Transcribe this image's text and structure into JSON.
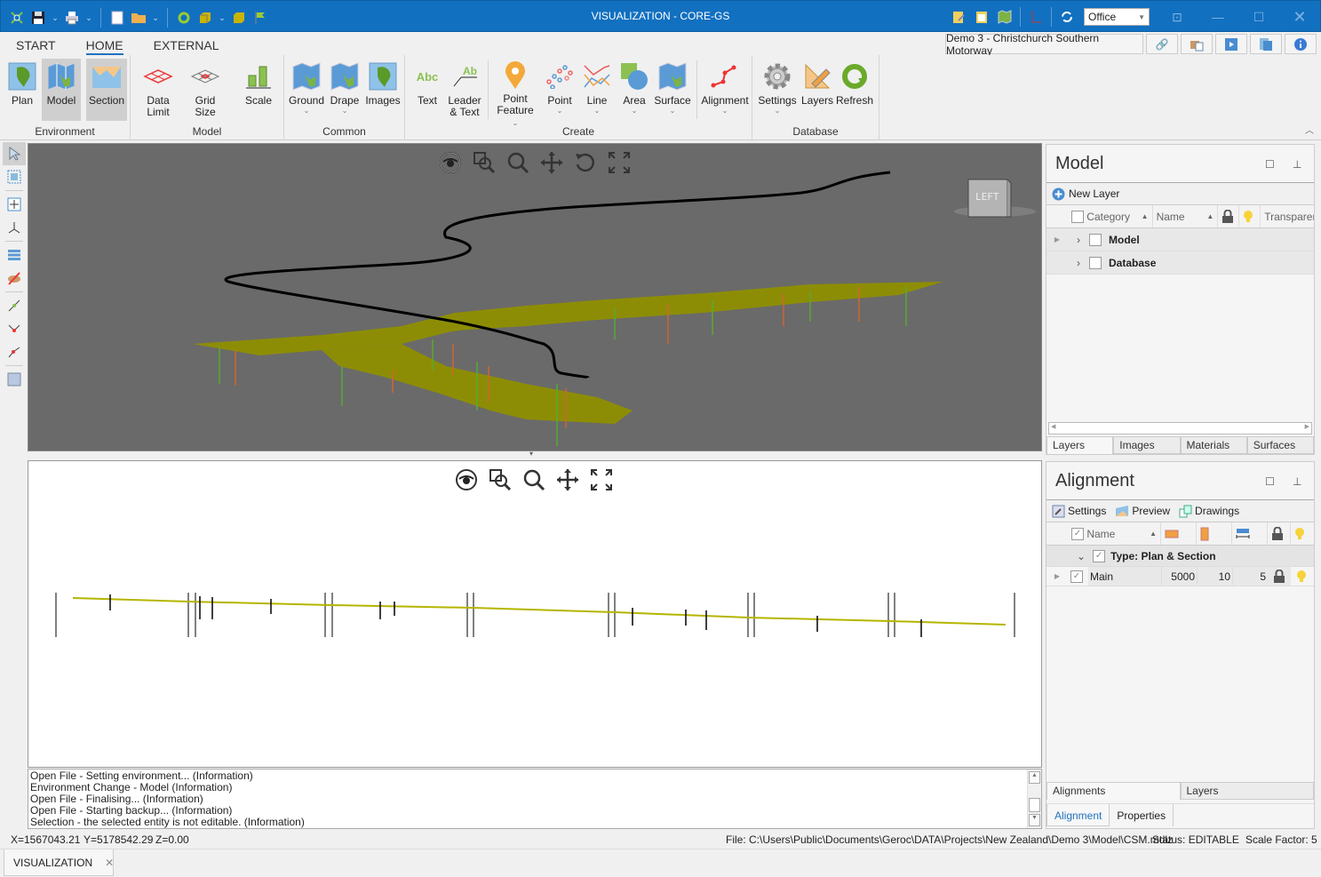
{
  "titlebar": {
    "title": "VISUALIZATION - CORE-GS",
    "qat_icons": [
      "app-logo-icon",
      "save-icon",
      "print-icon",
      "new-document-icon",
      "open-folder-icon",
      "refresh-icon",
      "yellow-box-icon",
      "yellow-cube-icon",
      "flag-icon"
    ],
    "right_icons": [
      "edit-notes-icon",
      "clipboard-icon",
      "map-icon",
      "chart-axis-icon",
      "sync-icon"
    ],
    "theme_value": "Office",
    "window_buttons": [
      "restore-icon",
      "minimize-icon",
      "maximize-icon",
      "close-icon"
    ]
  },
  "tabs": [
    {
      "label": "START"
    },
    {
      "label": "HOME",
      "active": true
    },
    {
      "label": "EXTERNAL"
    }
  ],
  "project_name": "Demo 3 - Christchurch Southern Motorway",
  "project_icons": [
    "link-icon",
    "briefcase-icon",
    "video-icon",
    "help-book-icon",
    "info-icon"
  ],
  "ribbon": {
    "groups": [
      {
        "label": "Environment",
        "buttons": [
          {
            "label": "Plan"
          },
          {
            "label": "Model",
            "selected": true
          },
          {
            "label": "Section",
            "selected": true
          }
        ]
      },
      {
        "label": "Model",
        "buttons": [
          {
            "label": "Data Limit"
          },
          {
            "label": "Grid Size"
          },
          {
            "label": "Scale"
          }
        ]
      },
      {
        "label": "Common",
        "buttons": [
          {
            "label": "Ground"
          },
          {
            "label": "Drape"
          },
          {
            "label": "Images"
          }
        ]
      },
      {
        "label": "Create",
        "buttons": [
          {
            "label": "Text"
          },
          {
            "label": "Leader",
            "label2": "& Text"
          },
          {
            "label": "Point",
            "label2": "Feature"
          },
          {
            "label": "Point"
          },
          {
            "label": "Line"
          },
          {
            "label": "Area"
          },
          {
            "label": "Surface"
          },
          {
            "label": "Alignment"
          }
        ]
      },
      {
        "label": "Database",
        "buttons": [
          {
            "label": "Settings"
          },
          {
            "label": "Layers"
          },
          {
            "label": "Refresh"
          }
        ]
      }
    ]
  },
  "left_toolbar": [
    "select-arrow-icon",
    "box-select-icon",
    "move-points-icon",
    "axis-icon",
    "layers-stack-icon",
    "hide-icon",
    "line-segment-icon",
    "polyline-edit-icon",
    "line-draw-icon",
    "rectangle-icon"
  ],
  "view_3d": {
    "nav_icons": [
      "orbit-eye-icon",
      "zoom-window-icon",
      "zoom-icon",
      "pan-icon",
      "rotate-icon",
      "zoom-extents-icon"
    ],
    "view_cube_label": "LEFT"
  },
  "view_section": {
    "nav_icons": [
      "orbit-eye-icon",
      "zoom-window-icon",
      "zoom-icon",
      "pan-icon",
      "zoom-extents-icon"
    ]
  },
  "log": [
    "Open File - Setting environment... (Information)",
    "Environment Change - Model (Information)",
    "Open File - Finalising... (Information)",
    "Open File - Starting backup... (Information)",
    "Selection - the selected entity is not editable. (Information)"
  ],
  "status": {
    "x": "X=1567043.21",
    "y": "Y=5178542.29",
    "z": "Z=0.00",
    "file": "File: C:\\Users\\Public\\Documents\\Geroc\\DATA\\Projects\\New Zealand\\Demo 3\\Model\\CSM.mdlz",
    "state": "Status: EDITABLE",
    "scale": "Scale Factor: 5"
  },
  "doc_tab": "VISUALIZATION",
  "model_panel": {
    "title": "Model",
    "new_layer": "New Layer",
    "columns": [
      "Category",
      "Name",
      "Transparen"
    ],
    "rows": [
      "Model",
      "Database"
    ],
    "tabs": [
      "Layers",
      "Images",
      "Materials",
      "Surfaces"
    ]
  },
  "alignment_panel": {
    "title": "Alignment",
    "toolbar": [
      "Settings",
      "Preview",
      "Drawings"
    ],
    "columns": [
      "Name"
    ],
    "group_label": "Type: Plan & Section",
    "rows": [
      {
        "name": "Main",
        "v1": "5000",
        "v2": "10",
        "v3": "5"
      }
    ],
    "tabs": [
      "Alignments",
      "Layers"
    ],
    "bottom_tabs": [
      "Alignment",
      "Properties"
    ]
  },
  "colors": {
    "accent": "#1270c0",
    "viewport_bg": "#6a6a6a",
    "surface": "#8f8f00",
    "alignment_line": "#000000"
  }
}
